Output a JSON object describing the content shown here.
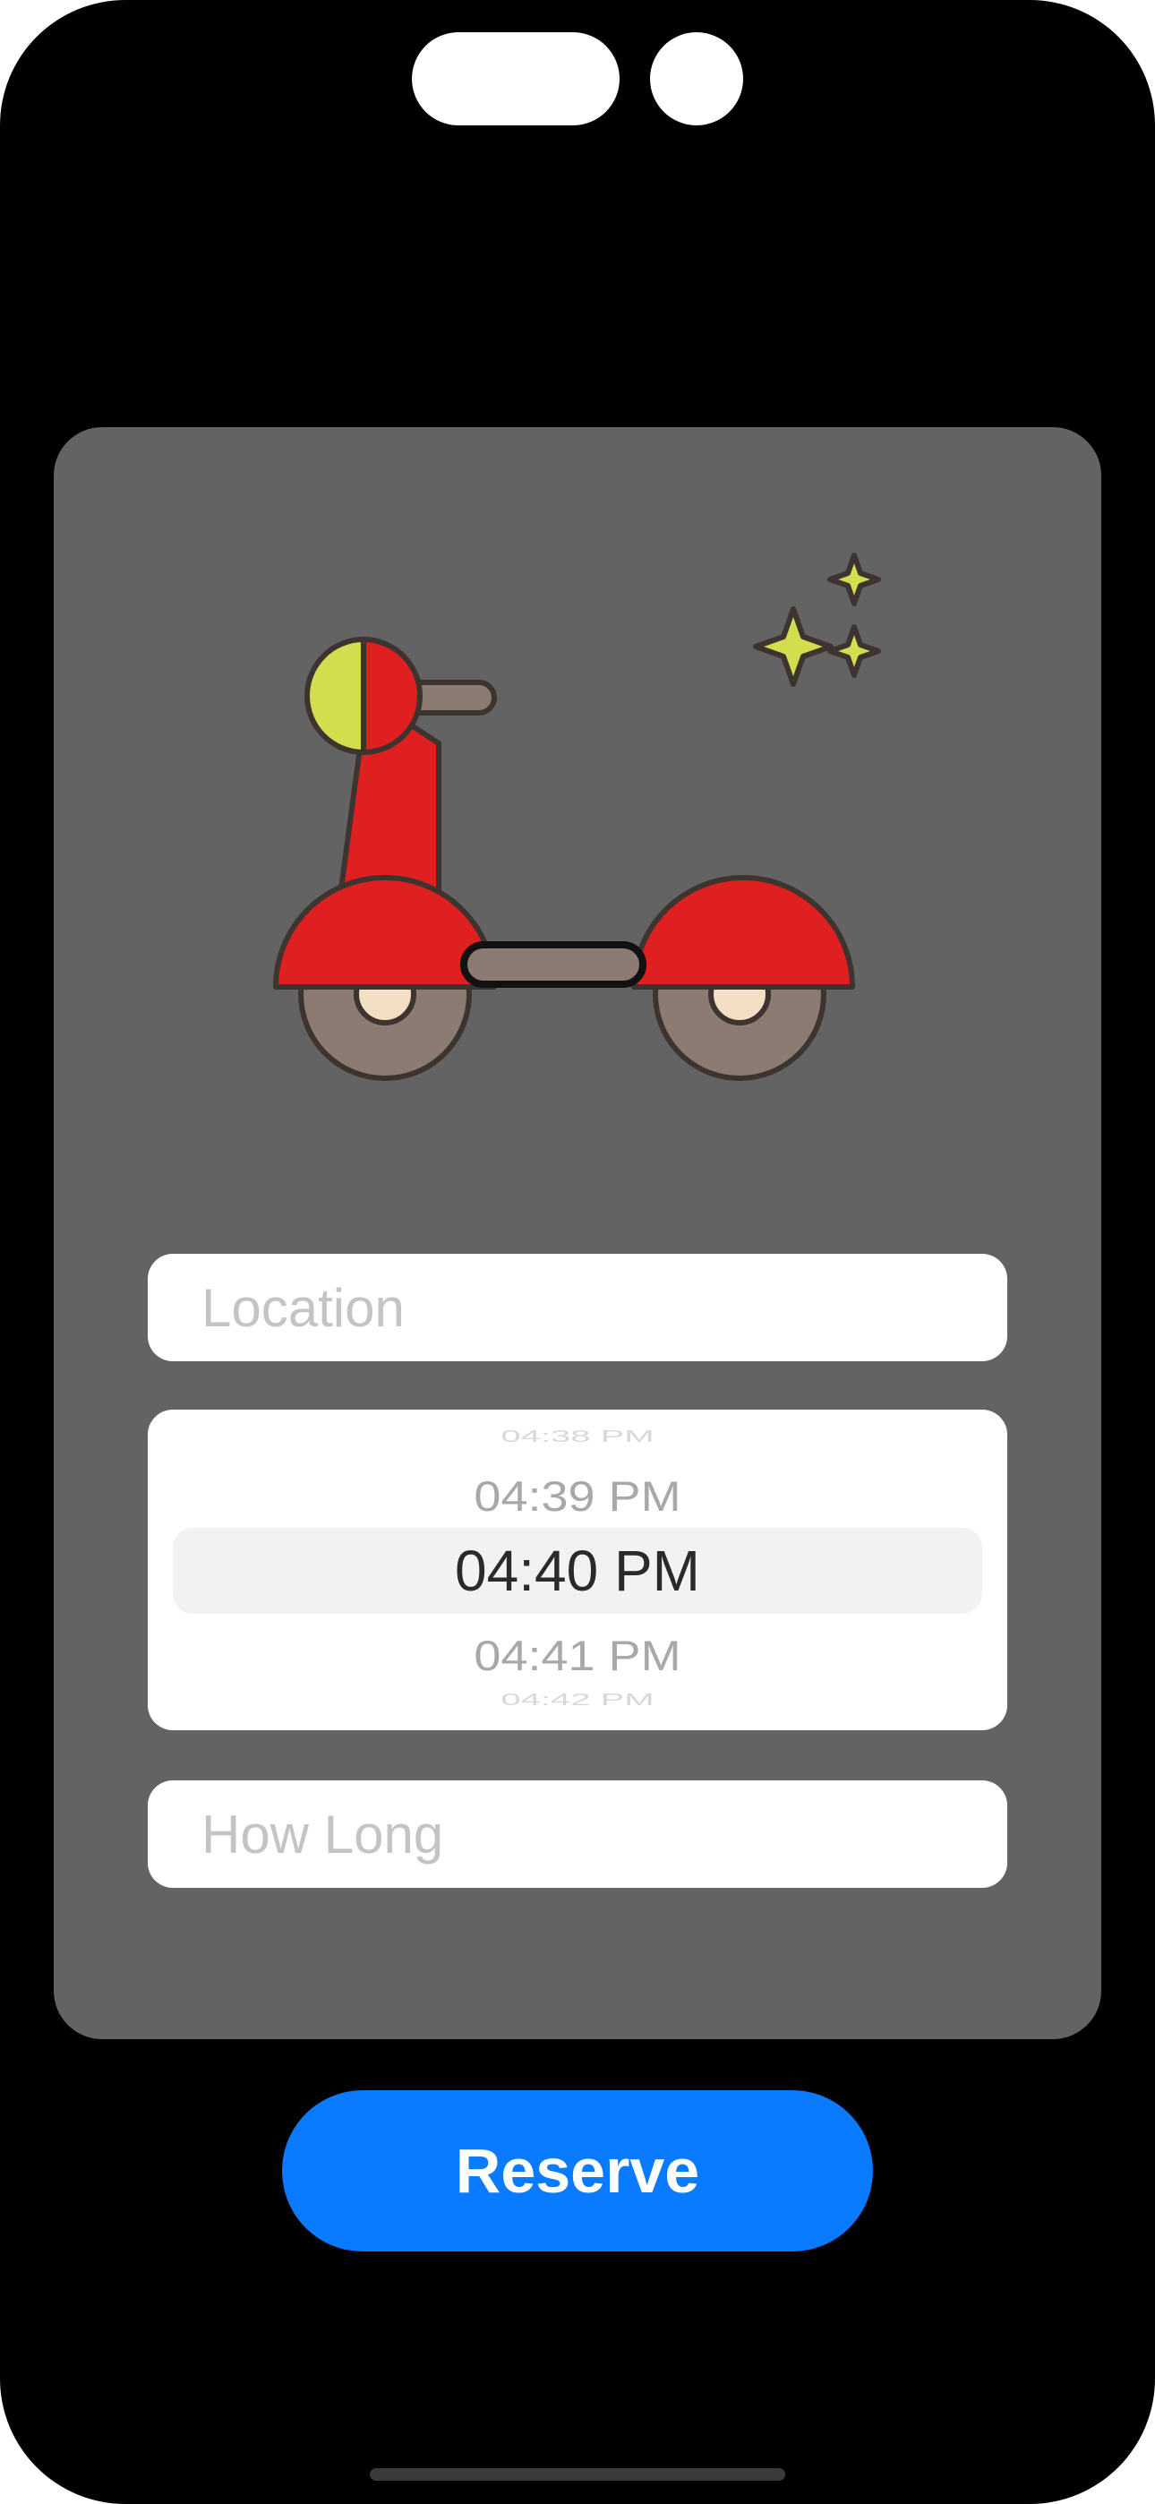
{
  "form": {
    "location_placeholder": "Location",
    "how_long_placeholder": "How Long",
    "reserve_label": "Reserve"
  },
  "time_picker": {
    "prev_edge": "04:38 PM",
    "prev": "04:39 PM",
    "selected": "04:40 PM",
    "next": "04:41 PM",
    "next_edge": "04:42 PM"
  },
  "illustration": {
    "icon": "scooter-icon",
    "accent_icon": "sparkles-icon",
    "colors": {
      "body": "#e02020",
      "light": "#d4dd4e",
      "wheel": "#8c7b72",
      "outline": "#3d3430"
    }
  },
  "colors": {
    "device_bezel": "#000000",
    "card_background": "#636363",
    "field_background": "#ffffff",
    "placeholder_text": "#c4c4c4",
    "primary_button": "#0a7aff"
  }
}
